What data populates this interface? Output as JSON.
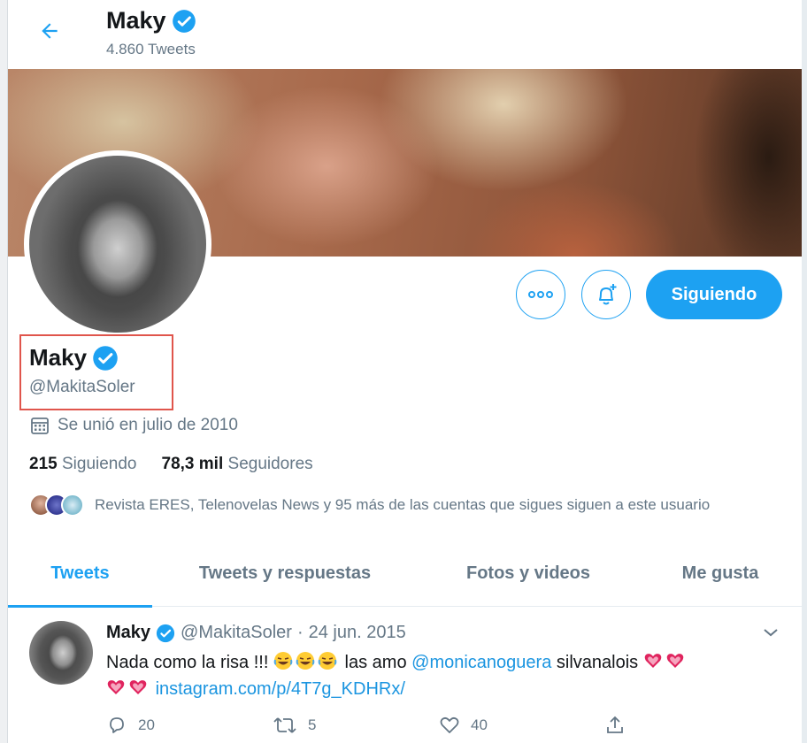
{
  "header": {
    "back_label": "Back",
    "title": "Maky",
    "tweet_count": "4.860 Tweets"
  },
  "profile": {
    "name": "Maky",
    "handle": "@MakitaSoler",
    "joined": "Se unió en julio de 2010",
    "following_count": "215",
    "following_label": "Siguiendo",
    "followers_count": "78,3 mil",
    "followers_label": "Seguidores",
    "followed_by": "Revista ERES, Telenovelas News y 95 más de las cuentas que sigues siguen a este usuario",
    "verified": true
  },
  "actions": {
    "more_icon": "more-icon",
    "bell_icon": "bell-plus-icon",
    "following_button": "Siguiendo"
  },
  "tabs": [
    {
      "label": "Tweets",
      "active": true
    },
    {
      "label": "Tweets y respuestas",
      "active": false
    },
    {
      "label": "Fotos y videos",
      "active": false
    },
    {
      "label": "Me gusta",
      "active": false
    }
  ],
  "tweet": {
    "name": "Maky",
    "handle": "@MakitaSoler",
    "dot": "·",
    "date": "24 jun. 2015",
    "text_part1": "Nada como la risa !!!",
    "text_part2": "las amo",
    "mention": "@monicanoguera",
    "text_part3": "silvanalois",
    "link": "instagram.com/p/4T7g_KDHRx/",
    "replies": "20",
    "retweets": "5",
    "likes": "40"
  },
  "colors": {
    "accent": "#1da1f2",
    "secondary_text": "#657786",
    "highlight_box": "#e0554c",
    "heart": "#e0245e"
  }
}
